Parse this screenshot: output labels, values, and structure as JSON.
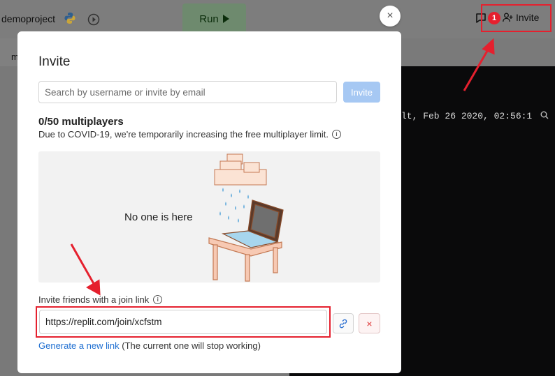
{
  "app": {
    "project_name": "demoproject",
    "run_label": "Run",
    "tab_partial": "m",
    "notification_count": "1",
    "invite_label": "Invite",
    "console_line": "lt, Feb 26 2020, 02:56:1"
  },
  "modal": {
    "close_glyph": "×",
    "title": "Invite",
    "search_placeholder": "Search by username or invite by email",
    "invite_button": "Invite",
    "multiplayer_count": "0/50 multiplayers",
    "covid_note": "Due to COVID-19, we're temporarily increasing the free multiplayer limit.",
    "empty_text": "No one is here",
    "join_link_label": "Invite friends with a join link",
    "join_link_value": "https://replit.com/join/xcfstm",
    "delete_glyph": "×",
    "generate_link": "Generate a new link",
    "generate_note": " (The current one will stop working)"
  },
  "colors": {
    "accent_red": "#e5202e",
    "link_blue": "#1f6fd1",
    "invite_button_bg": "#a6c8f3"
  },
  "icons": [
    "python-icon",
    "history-icon",
    "play-icon",
    "chat-icon",
    "add-user-icon",
    "info-icon",
    "link-icon",
    "close-icon",
    "search-icon"
  ]
}
